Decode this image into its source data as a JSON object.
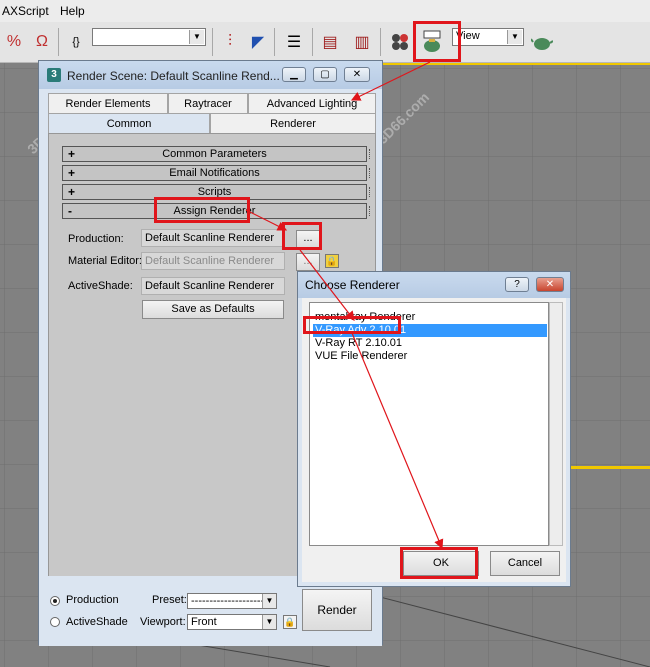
{
  "menu": {
    "items": [
      "AXScript",
      "Help"
    ]
  },
  "toolbar": {
    "view_label": "View"
  },
  "render_scene": {
    "title": "Render Scene: Default Scanline Rend...",
    "tabs_back": [
      "Render Elements",
      "Raytracer",
      "Advanced Lighting"
    ],
    "tabs_front": [
      "Common",
      "Renderer"
    ],
    "rollouts": [
      {
        "sign": "+",
        "label": "Common Parameters"
      },
      {
        "sign": "+",
        "label": "Email Notifications"
      },
      {
        "sign": "+",
        "label": "Scripts"
      },
      {
        "sign": "-",
        "label": "Assign Renderer"
      }
    ],
    "production_label": "Production:",
    "production_value": "Default Scanline Renderer",
    "material_editor_label": "Material Editor:",
    "material_editor_value": "Default Scanline Renderer",
    "activeshade_label": "ActiveShade:",
    "activeshade_value": "Default Scanline Renderer",
    "browse_label": "...",
    "save_defaults_label": "Save as Defaults",
    "mode_production_label": "Production",
    "mode_activeshade_label": "ActiveShade",
    "preset_label": "Preset:",
    "preset_value": "----------------------------",
    "viewport_label": "Viewport:",
    "viewport_value": "Front",
    "render_button_label": "Render"
  },
  "choose_renderer": {
    "title": "Choose Renderer",
    "help_label": "?",
    "items": [
      "mental ray Renderer",
      "V-Ray Adv 2.10.01",
      "V-Ray RT 2.10.01",
      "VUE File Renderer"
    ],
    "selected_index": 1,
    "ok_label": "OK",
    "cancel_label": "Cancel"
  },
  "colors": {
    "highlight_red": "#e0151b",
    "selection_blue": "#3399ff",
    "dialog_bg": "#dbe5f1",
    "viewport_frame": "#f0c800"
  }
}
